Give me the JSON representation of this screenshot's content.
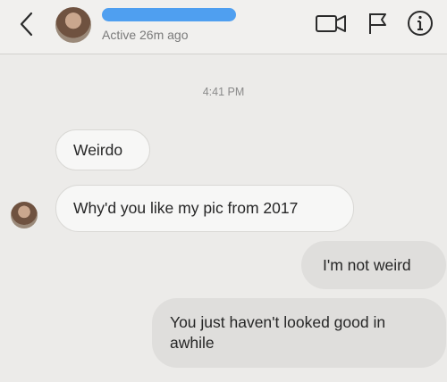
{
  "header": {
    "status": "Active 26m ago",
    "icons": [
      "back-chevron-icon",
      "video-call-icon",
      "flag-icon",
      "info-icon"
    ]
  },
  "thread": {
    "timestamp": "4:41 PM",
    "messages": [
      {
        "direction": "incoming",
        "text": "Weirdo"
      },
      {
        "direction": "incoming",
        "text": "Why'd you like my pic from 2017"
      },
      {
        "direction": "outgoing",
        "text": "I'm not weird"
      },
      {
        "direction": "outgoing",
        "text": "You just haven't looked good in awhile"
      }
    ]
  },
  "colors": {
    "background": "#ecebe9",
    "incoming_bubble": "#f7f7f6",
    "outgoing_bubble": "#dfdedc",
    "name_redaction": "#4f9ff0"
  }
}
